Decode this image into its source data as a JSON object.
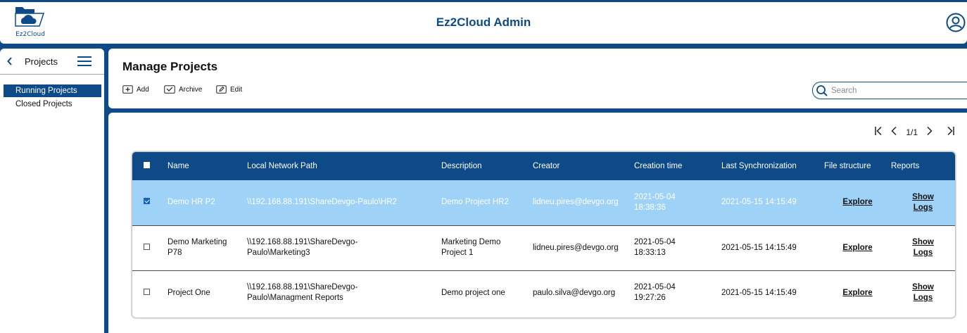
{
  "app": {
    "logo_text": "Ez2Cloud",
    "title": "Ez2Cloud Admin",
    "user_icon": "user-circle-icon"
  },
  "sidebar": {
    "title": "Projects",
    "items": [
      {
        "label": "Running Projects",
        "active": true
      },
      {
        "label": "Closed Projects",
        "active": false
      }
    ]
  },
  "manage": {
    "title": "Manage Projects",
    "toolbar": {
      "add_label": "Add",
      "archive_label": "Archive",
      "edit_label": "Edit"
    },
    "search": {
      "placeholder": "Search",
      "value": ""
    }
  },
  "pagination": {
    "page_label": "1/1"
  },
  "table": {
    "columns": [
      "Name",
      "Local Network Path",
      "Description",
      "Creator",
      "Creation time",
      "Last Synchronization",
      "File structure",
      "Reports"
    ],
    "rows": [
      {
        "checked": true,
        "name": "Demo HR P2",
        "path": "\\\\192.168.88.191\\ShareDevgo-Paulo\\HR2",
        "description": "Demo Project HR2",
        "creator": "lidneu.pires@devgo.org",
        "creation_time": "2021-05-04\n18:38:36",
        "last_sync": "2021-05-15 14:15:49",
        "file_structure": "Explore",
        "reports": "Show\nLogs"
      },
      {
        "checked": false,
        "name": "Demo Marketing\nP78",
        "path": "\\\\192.168.88.191\\ShareDevgo-\nPaulo\\Marketing3",
        "description": "Marketing Demo\nProject 1",
        "creator": "lidneu.pires@devgo.org",
        "creation_time": "2021-05-04\n18:33:13",
        "last_sync": "2021-05-15 14:15:49",
        "file_structure": "Explore",
        "reports": "Show\nLogs"
      },
      {
        "checked": false,
        "name": "Project One",
        "path": "\\\\192.168.88.191\\ShareDevgo-\nPaulo\\Managment Reports",
        "description": "Demo project one",
        "creator": "paulo.silva@devgo.org",
        "creation_time": "2021-05-04\n19:27:26",
        "last_sync": "2021-05-15 14:15:49",
        "file_structure": "Explore",
        "reports": "Show\nLogs"
      }
    ]
  },
  "colors": {
    "brand": "#0d4a87",
    "selected_row": "#9fd2f7",
    "checkbox_checked": "#1565c0"
  }
}
